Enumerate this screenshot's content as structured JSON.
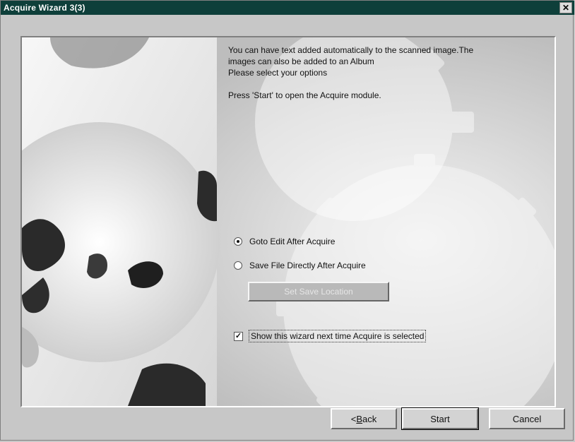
{
  "window": {
    "title": "Acquire Wizard 3(3)",
    "close_glyph": "✕",
    "close_icon": "close-icon"
  },
  "body": {
    "intro_line1": "You can have text added automatically to the scanned image.The",
    "intro_line2": "images can also be added to an Album",
    "intro_line3": "Please select your options",
    "start_hint": "Press 'Start' to open the Acquire module."
  },
  "options": {
    "radio1": {
      "label": "Goto Edit After Acquire",
      "checked": true
    },
    "radio2": {
      "label": "Save File Directly After Acquire",
      "checked": false
    },
    "disabled_button": "Set Save Location",
    "checkbox": {
      "label": "Show this wizard next time Acquire is selected",
      "checked": true
    }
  },
  "buttons": {
    "back": "< Back",
    "back_prefix": "< ",
    "back_mnemonic": "B",
    "back_rest": "ack",
    "start": "Start",
    "cancel": "Cancel"
  },
  "colors": {
    "titlebar": "#0e3f3a",
    "dialog_bg": "#c7c7c7"
  }
}
